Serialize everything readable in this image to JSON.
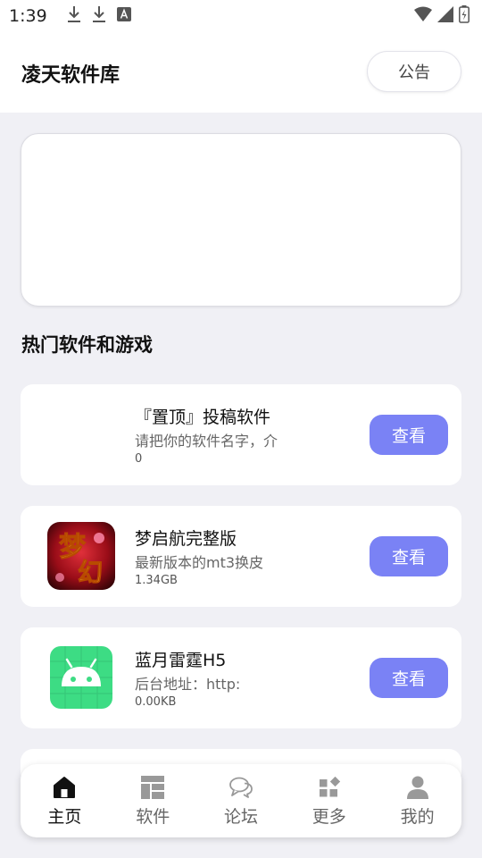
{
  "status_bar": {
    "time": "1:39"
  },
  "header": {
    "title": "凌天软件库",
    "notice_label": "公告"
  },
  "section": {
    "title": "热门软件和游戏"
  },
  "items": [
    {
      "name": "『置顶』投稿软件",
      "desc": "请把你的软件名字，介",
      "meta": "0",
      "button": "查看",
      "icon": "none"
    },
    {
      "name": "梦启航完整版",
      "desc": "最新版本的mt3换皮",
      "meta": "1.34GB",
      "button": "查看",
      "icon": "game-logo-icon"
    },
    {
      "name": "蓝月雷霆H5",
      "desc": "后台地址：http:",
      "meta": "0.00KB",
      "button": "查看",
      "icon": "android-icon"
    }
  ],
  "nav": [
    {
      "label": "主页",
      "icon": "home-icon",
      "active": true
    },
    {
      "label": "软件",
      "icon": "grid-icon"
    },
    {
      "label": "论坛",
      "icon": "chat-icon"
    },
    {
      "label": "更多",
      "icon": "apps-icon"
    },
    {
      "label": "我的",
      "icon": "user-icon"
    }
  ],
  "colors": {
    "accent": "#7a82f5",
    "background": "#f0f0f5"
  }
}
